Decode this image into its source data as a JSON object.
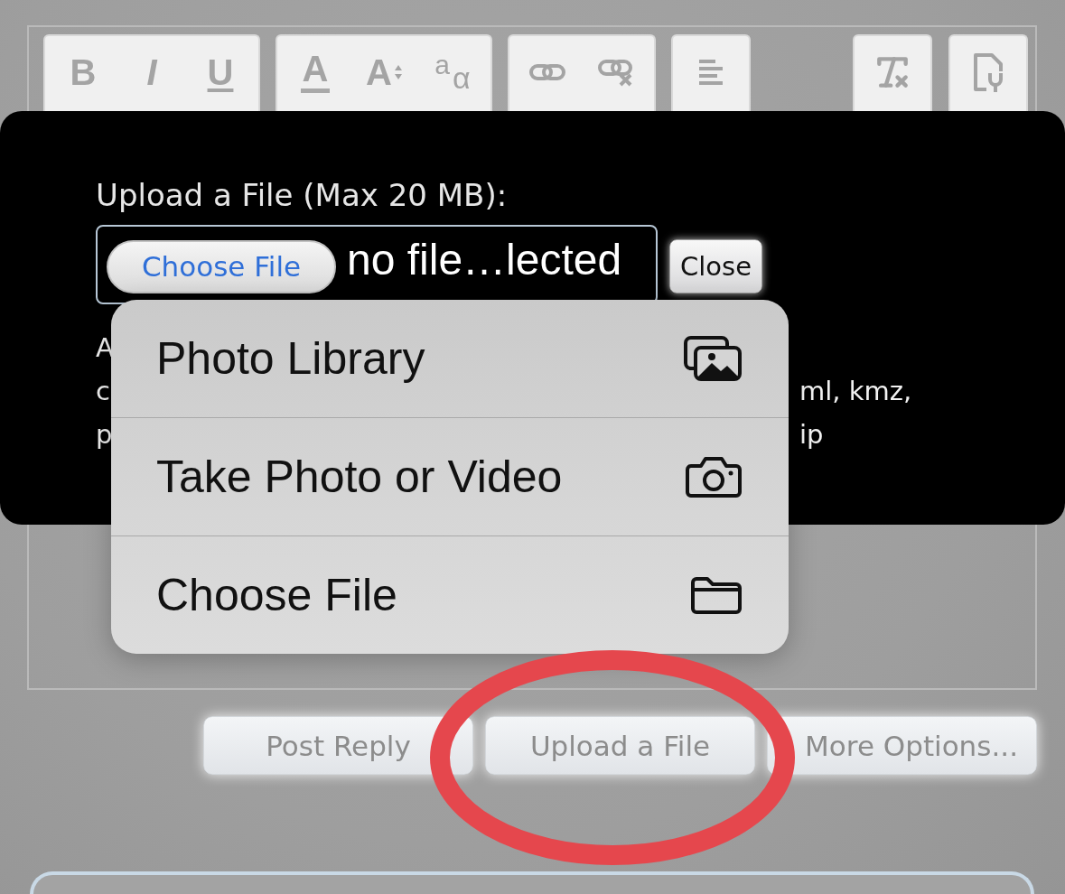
{
  "editor": {
    "toolbar": {
      "left_groups": [
        {
          "tools": [
            {
              "kind": "bold",
              "glyph": "B"
            },
            {
              "kind": "italic",
              "glyph": "I"
            },
            {
              "kind": "underline",
              "glyph": "U"
            }
          ]
        },
        {
          "tools": [
            {
              "kind": "font_color",
              "glyph": "A"
            },
            {
              "kind": "font_size",
              "glyph": "A"
            },
            {
              "kind": "special_chars",
              "glyphs": [
                "a",
                "α"
              ]
            }
          ]
        },
        {
          "tools": [
            {
              "kind": "link"
            },
            {
              "kind": "unlink"
            }
          ]
        },
        {
          "tools": [
            {
              "kind": "align"
            }
          ]
        }
      ],
      "right_groups": [
        {
          "tools": [
            {
              "kind": "clear_format"
            }
          ]
        },
        {
          "tools": [
            {
              "kind": "source"
            }
          ]
        }
      ]
    }
  },
  "upload_panel": {
    "label": "Upload a File (Max 20 MB):",
    "file_input": {
      "button": "Choose File",
      "value": "no file…lected"
    },
    "close_button": "Close",
    "file_types_lines": [
      {
        "start": "A"
      },
      {
        "start": "c",
        "end": "ml, kmz,"
      },
      {
        "start": "p",
        "end": "ip"
      }
    ]
  },
  "source_menu": {
    "items": [
      {
        "label": "Photo Library"
      },
      {
        "label": "Take Photo or Video"
      },
      {
        "label": "Choose File"
      }
    ]
  },
  "actions": [
    "Post Reply",
    "Upload a File",
    "More Options..."
  ]
}
